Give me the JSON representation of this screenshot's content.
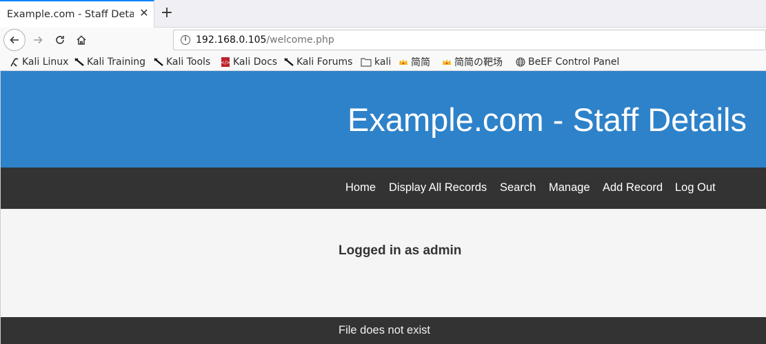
{
  "browser": {
    "tab_title": "Example.com - Staff Details",
    "url_host": "192.168.0.105",
    "url_path": "/welcome.php",
    "bookmarks": [
      {
        "label": "Kali Linux",
        "icon": "kali-dragon-icon"
      },
      {
        "label": "Kali Training",
        "icon": "kali-icon"
      },
      {
        "label": "Kali Tools",
        "icon": "kali-icon"
      },
      {
        "label": "Kali Docs",
        "icon": "kali-docs-icon"
      },
      {
        "label": "Kali Forums",
        "icon": "kali-icon"
      },
      {
        "label": "kali",
        "icon": "folder-icon"
      },
      {
        "label": "简简",
        "icon": "crown-icon"
      },
      {
        "label": "简简の靶场",
        "icon": "crown-icon"
      },
      {
        "label": "BeEF Control Panel",
        "icon": "globe-icon"
      }
    ]
  },
  "site": {
    "title": "Example.com - Staff Details",
    "header_color": "#2e82c9",
    "menu": [
      "Home",
      "Display All Records",
      "Search",
      "Manage",
      "Add Record",
      "Log Out"
    ],
    "status": "Logged in as admin",
    "footer": "File does not exist"
  }
}
